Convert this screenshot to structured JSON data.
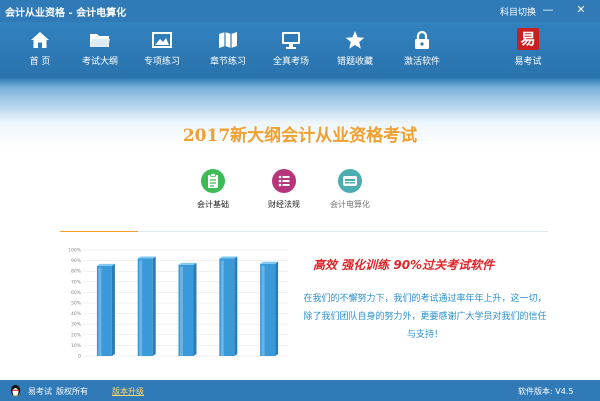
{
  "window": {
    "title": "会计从业资格 - 会计电算化",
    "subject_switch": "科目切换",
    "minimize": "—",
    "close": "✕"
  },
  "toolbar": {
    "items": [
      {
        "label": "首 页",
        "icon": "home-icon"
      },
      {
        "label": "考试大纲",
        "icon": "folder-icon"
      },
      {
        "label": "专项练习",
        "icon": "picture-icon"
      },
      {
        "label": "章节练习",
        "icon": "map-icon"
      },
      {
        "label": "全真考场",
        "icon": "monitor-icon"
      },
      {
        "label": "错题收藏",
        "icon": "star-icon"
      },
      {
        "label": "激活软件",
        "icon": "lock-icon"
      },
      {
        "label": "易考试",
        "icon": "brand-logo-icon",
        "logo_text": "易"
      }
    ]
  },
  "main": {
    "headline": "2017新大纲会计从业资格考试",
    "subjects": [
      {
        "label": "会计基础",
        "color": "#3dbb54",
        "icon": "clipboard-icon",
        "active": true
      },
      {
        "label": "财经法规",
        "color": "#b7357a",
        "icon": "list-icon",
        "active": true
      },
      {
        "label": "会计电算化",
        "color": "#4aaeb0",
        "icon": "computer-icon",
        "active": false
      }
    ],
    "slogan": "高效 强化训练 90%过关考试软件",
    "description": "在我们的不懈努力下，我们的考试通过率年年上升，这一切，除了我们团队自身的努力外，更要感谢广大学员对我们的信任与支持！"
  },
  "chart_data": {
    "type": "bar",
    "y_ticks": [
      "0",
      "10%",
      "20%",
      "30%",
      "40%",
      "50%",
      "60%",
      "70%",
      "80%",
      "90%",
      "100%"
    ],
    "ylim": [
      0,
      100
    ],
    "values": [
      85,
      92,
      86,
      92,
      87
    ],
    "bar_color": "#3a9ad8",
    "grid": true
  },
  "status": {
    "brand": "易考试",
    "copyright": "版权所有",
    "update_link": "版本升级",
    "version": "软件版本: V4.5"
  }
}
